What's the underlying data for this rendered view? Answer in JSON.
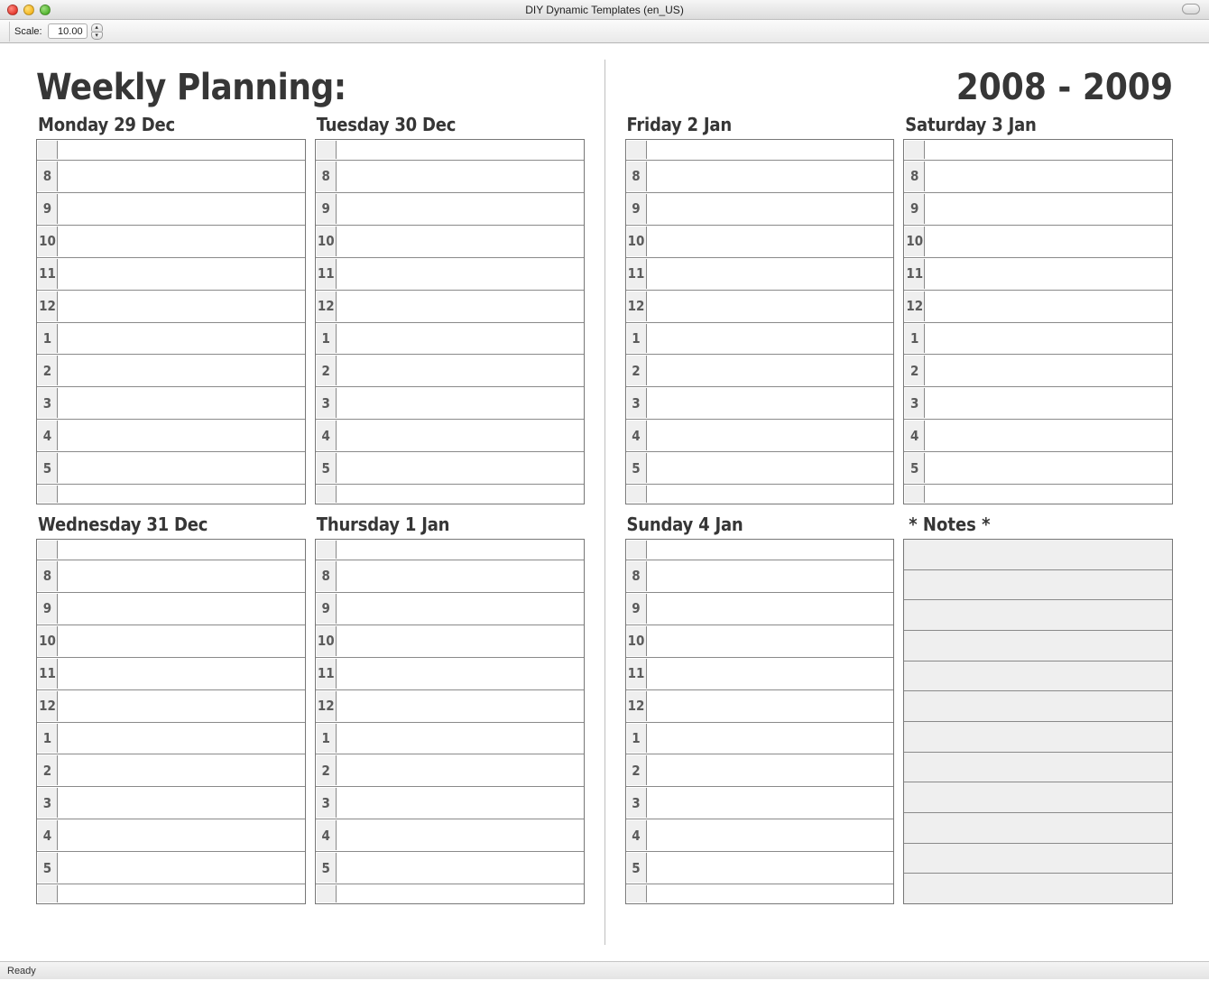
{
  "window": {
    "title": "DIY Dynamic Templates (en_US)"
  },
  "toolbar": {
    "scale_label": "Scale:",
    "scale_value": "10.00"
  },
  "status": {
    "text": "Ready"
  },
  "template": {
    "heading": "Weekly Planning:",
    "year_range": "2008 - 2009",
    "notes_label": "* Notes *",
    "hours": [
      "",
      "8",
      "9",
      "10",
      "11",
      "12",
      "1",
      "2",
      "3",
      "4",
      "5",
      ""
    ],
    "days_left": [
      {
        "label": "Monday 29 Dec"
      },
      {
        "label": "Tuesday 30 Dec"
      },
      {
        "label": "Wednesday 31 Dec"
      },
      {
        "label": "Thursday 1 Jan"
      }
    ],
    "days_right": [
      {
        "label": "Friday 2 Jan"
      },
      {
        "label": "Saturday 3 Jan"
      },
      {
        "label": "Sunday 4 Jan"
      }
    ],
    "notes_rows": 12
  }
}
